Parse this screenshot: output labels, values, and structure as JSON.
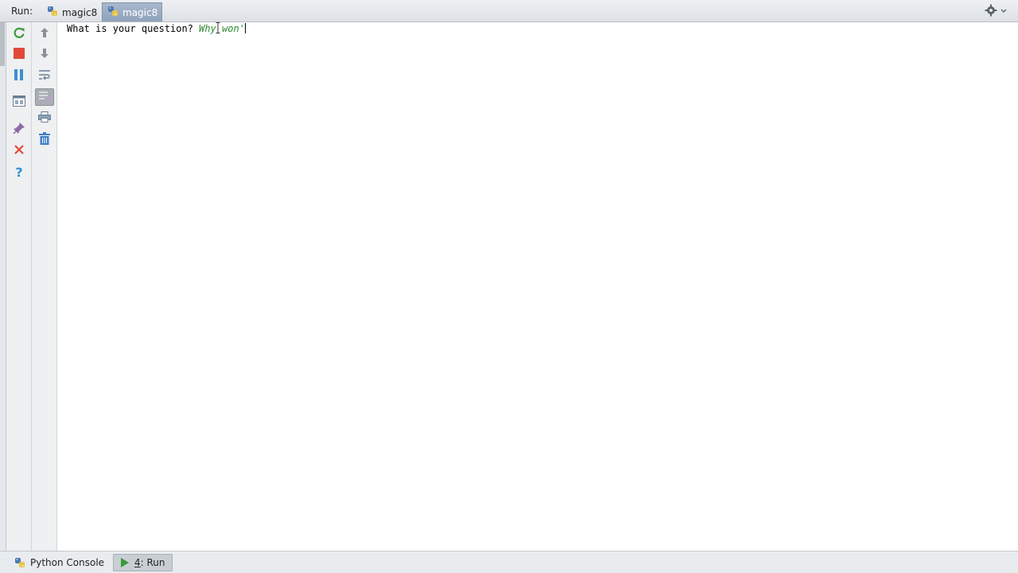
{
  "header": {
    "run_label": "Run:",
    "tabs": [
      {
        "label": "magic8",
        "icon": "python-icon",
        "active": false
      },
      {
        "label": "magic8",
        "icon": "python-icon",
        "active": true
      }
    ],
    "settings_icon": "gear-icon"
  },
  "toolbar_left": [
    {
      "name": "rerun-icon"
    },
    {
      "name": "stop-icon"
    },
    {
      "name": "pause-icon"
    },
    {
      "name": "restore-layout-icon"
    },
    {
      "name": "pin-icon"
    },
    {
      "name": "close-icon"
    },
    {
      "name": "help-icon"
    }
  ],
  "toolbar_right": [
    {
      "name": "up-arrow-icon"
    },
    {
      "name": "down-arrow-icon"
    },
    {
      "name": "soft-wrap-icon"
    },
    {
      "name": "scroll-to-end-icon",
      "pressed": true
    },
    {
      "name": "print-icon"
    },
    {
      "name": "trash-icon"
    }
  ],
  "console": {
    "prompt": "What is your question? ",
    "user_input": "Why won'"
  },
  "bottom_tabs": {
    "python_console": "Python Console",
    "run_number": "4",
    "run_label": ": Run"
  },
  "colors": {
    "user_input": "#2e8b2e",
    "active_tab": "#8fa3bd",
    "stop_red": "#e0493a",
    "rerun_green": "#3a9a3a",
    "help_blue": "#2f8fd6"
  }
}
